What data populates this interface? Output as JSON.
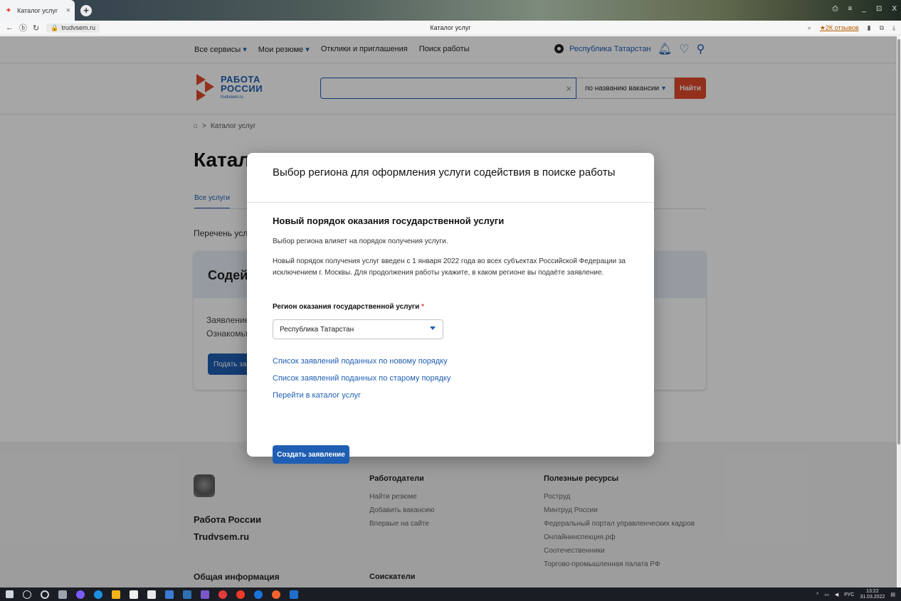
{
  "browser": {
    "tab_title": "Каталог услуг",
    "tab_close": "×",
    "new_tab": "+",
    "url": "trudvsem.ru",
    "page_title": "Каталог услуг",
    "reviews": "★2К отзывов",
    "window_controls": [
      "⎙",
      "≡",
      "_",
      "⊡",
      "X"
    ]
  },
  "topnav": {
    "items": [
      "Все сервисы",
      "Мои резюме",
      "Отклики и приглашения",
      "Поиск работы"
    ],
    "region": "Республика Татарстан"
  },
  "header": {
    "logo_line1": "РАБОТА",
    "logo_line2": "РОССИИ",
    "logo_line3": "trudvsem.ru",
    "search_placeholder": "",
    "search_clear": "×",
    "search_type": "по названию вакансии",
    "search_button": "Найти"
  },
  "breadcrumb": {
    "separator": ">",
    "current": "Каталог услуг"
  },
  "main": {
    "title": "Катал",
    "tab_all": "Все услуги",
    "intro": "Перечень услу",
    "card_title": "Содейст",
    "card_desc_line1": "Заявление",
    "card_desc_line2": "Ознакомьт",
    "card_button": "Подать за"
  },
  "modal": {
    "title": "Выбор региона для оформления услуги содействия в поиске работы",
    "subtitle": "Новый порядок оказания государственной услуги",
    "para1": "Выбор региона влияет на порядок получения услуги.",
    "para2": "Новый порядок получения услуг введен с 1 января 2022 года во всех субъектах Российской Федерации за исключением г. Москвы. Для продолжения работы укажите, в каком регионе вы подаёте заявление.",
    "region_label": "Регион оказания государственной услуги",
    "required_mark": "*",
    "region_value": "Республика Татарстан",
    "link_new": "Список заявлений поданных по новому порядку",
    "link_old": "Список заявлений поданных по старому порядку",
    "link_catalog": "Перейти в каталог услуг",
    "create_button": "Создать заявление"
  },
  "footer": {
    "brand_line1": "Работа России",
    "brand_line2": "Trudvsem.ru",
    "general_info": "Общая информация",
    "employers_title": "Работодатели",
    "employers_links": [
      "Найти резюме",
      "Добавить вакансию",
      "Впервые на сайте"
    ],
    "seekers_title": "Соискатели",
    "resources_title": "Полезные ресурсы",
    "resources_links": [
      "Роструд",
      "Минтруд России",
      "Федеральный портал управленческих кадров",
      "Онлайнинспекция.рф",
      "Соотечественники",
      "Торгово-промышленная палата РФ"
    ]
  },
  "taskbar": {
    "lang": "РУС",
    "time": "13:22",
    "date": "31.03.2022"
  },
  "colors": {
    "brand_blue": "#1f5fb3",
    "accent_red": "#e04a2b"
  }
}
